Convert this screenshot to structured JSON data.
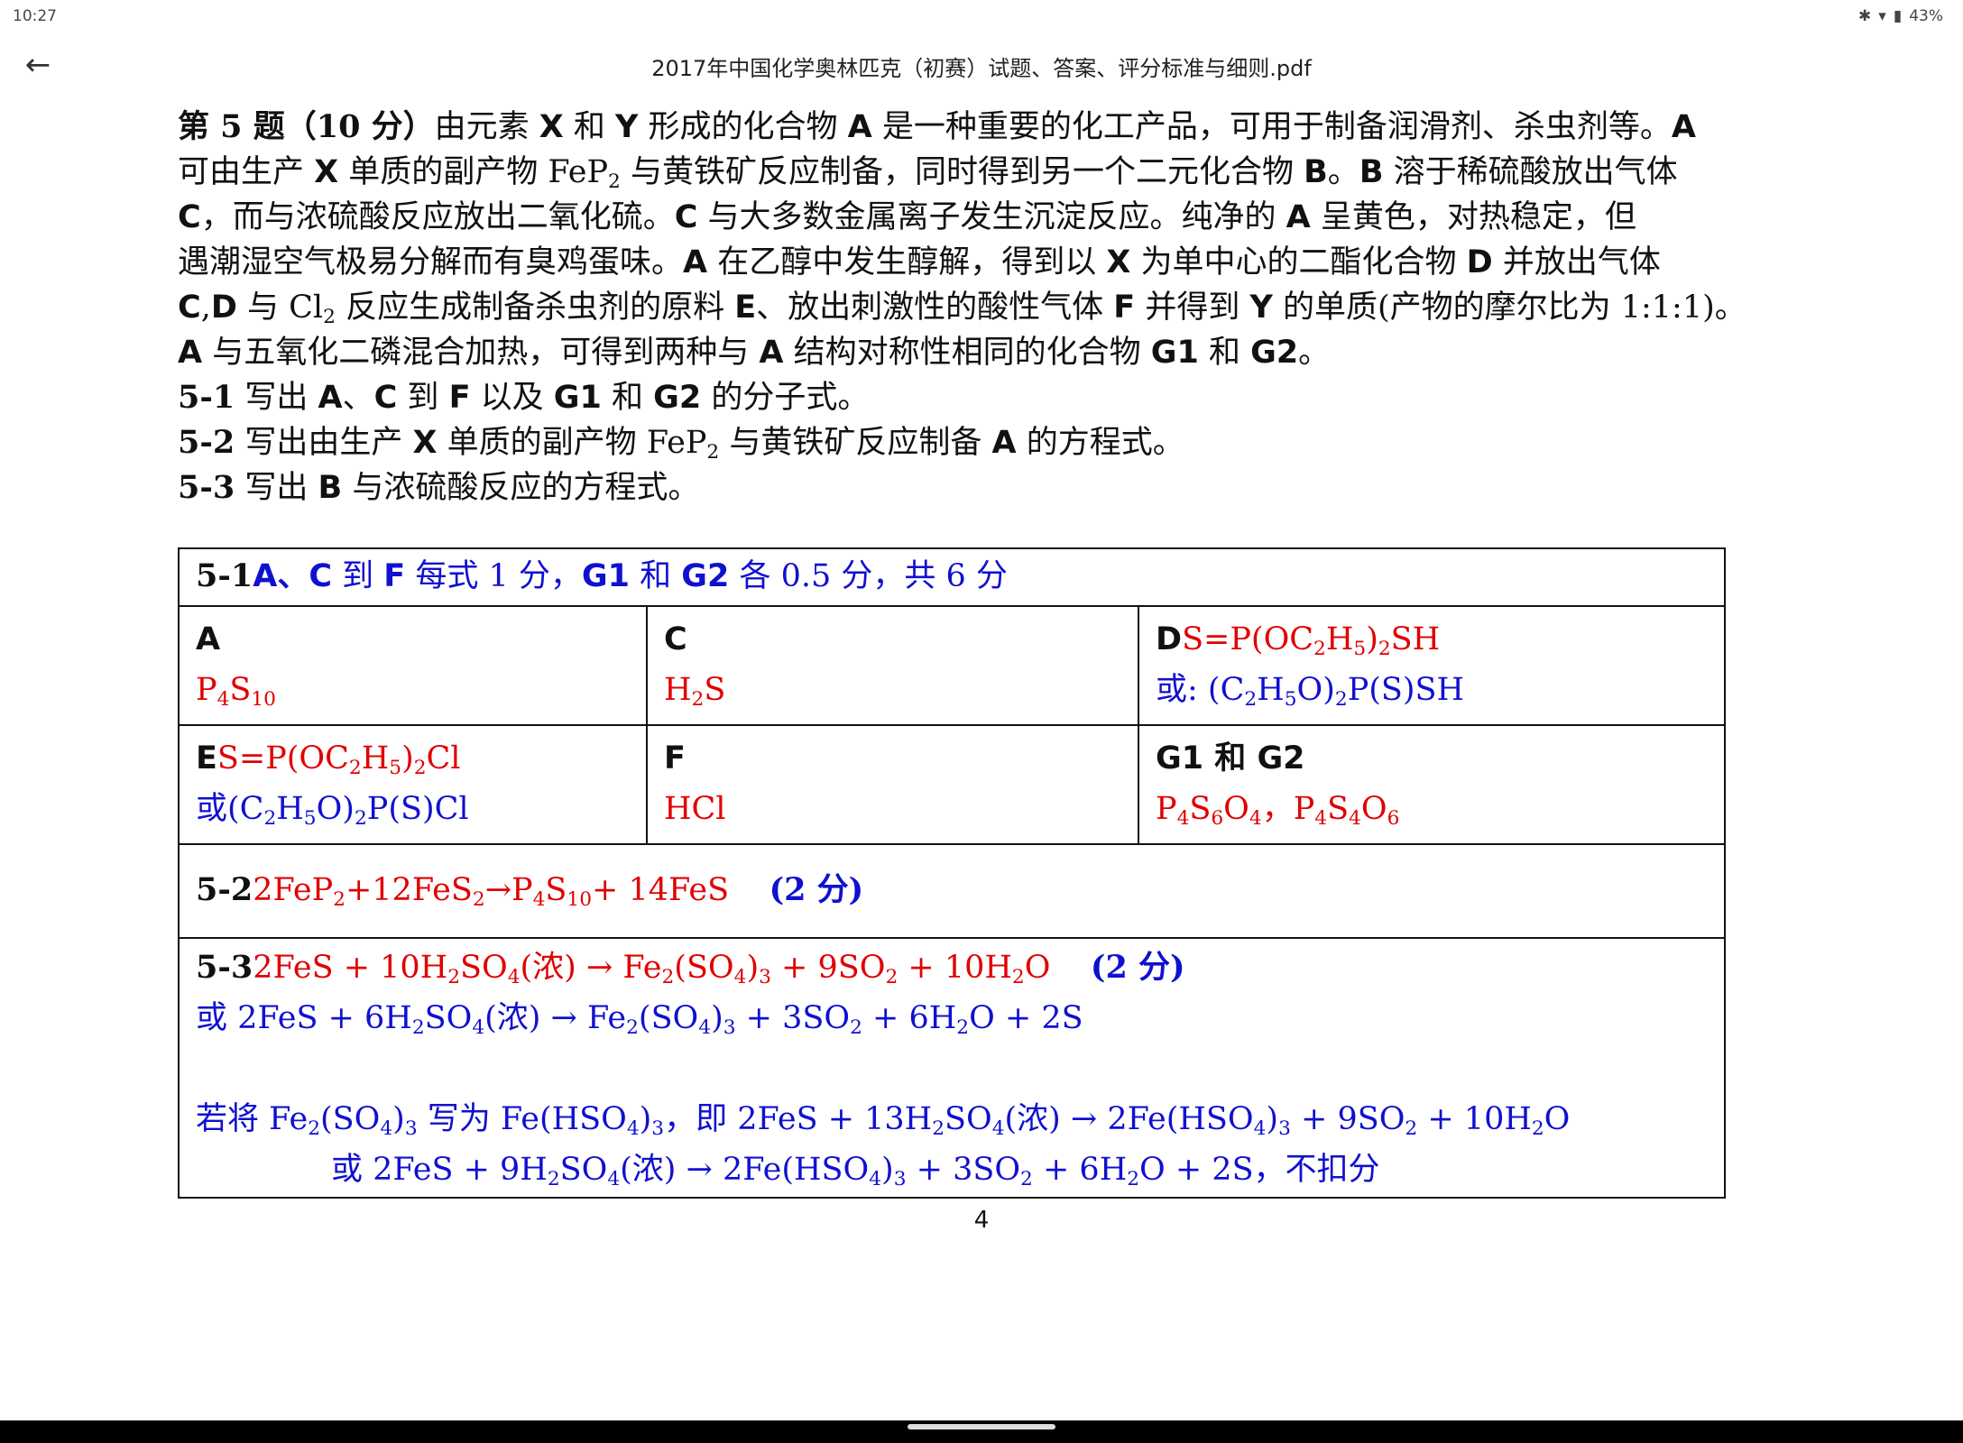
{
  "status": {
    "time": "10:27",
    "battery": "43%"
  },
  "header": {
    "title": "2017年中国化学奥林匹克（初赛）试题、答案、评分标准与细则.pdf"
  },
  "problem": {
    "l1a": "第 5 题（10 分）",
    "l1b": "由元素 ",
    "l1c": "X",
    "l1d": " 和 ",
    "l1e": "Y",
    "l1f": " 形成的化合物 ",
    "l1g": "A",
    "l1h": " 是一种重要的化工产品，可用于制备润滑剂、杀虫剂等。",
    "l1i": "A",
    "l2a": "可由生产 ",
    "l2b": "X",
    "l2c": " 单质的副产物 FeP",
    "l2d": "2",
    "l2e": " 与黄铁矿反应制备，同时得到另一个二元化合物 ",
    "l2f": "B",
    "l2g": "。",
    "l2h": "B",
    "l2i": " 溶于稀硫酸放出气体",
    "l3a": "C",
    "l3b": "，而与浓硫酸反应放出二氧化硫。",
    "l3c": "C",
    "l3d": " 与大多数金属离子发生沉淀反应。纯净的 ",
    "l3e": "A",
    "l3f": " 呈黄色，对热稳定，但",
    "l4a": "遇潮湿空气极易分解而有臭鸡蛋味。",
    "l4b": "A",
    "l4c": " 在乙醇中发生醇解，得到以 ",
    "l4d": "X",
    "l4e": " 为单中心的二酯化合物 ",
    "l4f": "D",
    "l4g": " 并放出气体",
    "l5a": "C",
    "l5b": ",",
    "l5c": "D",
    "l5d": " 与 Cl",
    "l5e": "2",
    "l5f": " 反应生成制备杀虫剂的原料 ",
    "l5g": "E",
    "l5h": "、放出刺激性的酸性气体 ",
    "l5i": "F",
    "l5j": " 并得到 ",
    "l5k": "Y",
    "l5l": " 的单质(产物的摩尔比为 1:1:1)。",
    "l6a": "A",
    "l6b": " 与五氧化二磷混合加热，可得到两种与 ",
    "l6c": "A",
    "l6d": " 结构对称性相同的化合物 ",
    "l6e": "G1",
    "l6f": " 和 ",
    "l6g": "G2",
    "l6h": "。",
    "q1a": "5-1",
    "q1b": " 写出 ",
    "q1c": "A",
    "q1d": "、",
    "q1e": "C",
    "q1f": " 到 ",
    "q1g": "F",
    "q1h": " 以及 ",
    "q1i": "G1",
    "q1j": " 和 ",
    "q1k": "G2",
    "q1l": " 的分子式。",
    "q2a": "5-2",
    "q2b": " 写出由生产 ",
    "q2c": "X",
    "q2d": " 单质的副产物 FeP",
    "q2e": "2",
    "q2f": " 与黄铁矿反应制备 ",
    "q2g": "A",
    "q2h": " 的方程式。",
    "q3a": "5-3",
    "q3b": " 写出 ",
    "q3c": "B",
    "q3d": " 与浓硫酸反应的方程式。"
  },
  "answer": {
    "h1a": "5-1",
    "h1b": "A、C",
    "h1c": " 到 ",
    "h1d": "F",
    "h1e": " 每式 1 分，",
    "h1f": "G1",
    "h1g": " 和 ",
    "h1h": "G2",
    "h1i": " 各 0.5 分，共 6 分",
    "A_label": "A",
    "A_val_a": "P",
    "A_val_b": "4",
    "A_val_c": "S",
    "A_val_d": "10",
    "C_label": "C",
    "C_val_a": "H",
    "C_val_b": "2",
    "C_val_c": "S",
    "D_label": "D",
    "D_a": "S=P(OC",
    "D_b": "2",
    "D_c": "H",
    "D_d": "5",
    "D_e": ")",
    "D_f": "2",
    "D_g": "SH",
    "D_alt_a": "或: (C",
    "D_alt_b": "2",
    "D_alt_c": "H",
    "D_alt_d": "5",
    "D_alt_e": "O)",
    "D_alt_f": "2",
    "D_alt_g": "P(S)SH",
    "E_label": "E",
    "E_a": "S=P(OC",
    "E_b": "2",
    "E_c": "H",
    "E_d": "5",
    "E_e": ")",
    "E_f": "2",
    "E_g": "Cl",
    "E_alt_a": "或(C",
    "E_alt_b": "2",
    "E_alt_c": "H",
    "E_alt_d": "5",
    "E_alt_e": "O)",
    "E_alt_f": "2",
    "E_alt_g": "P(S)Cl",
    "F_label": "F",
    "F_val": "HCl",
    "G_label": "G1 和 G2",
    "G_a": "P",
    "G_b": "4",
    "G_c": "S",
    "G_d": "6",
    "G_e": "O",
    "G_f": "4",
    "G_g": "，P",
    "G_h": "4",
    "G_i": "S",
    "G_j": "4",
    "G_k": "O",
    "G_l": "6",
    "q52_label": "5-2",
    "q52_a": "2FeP",
    "q52_b": "2",
    "q52_c": "+12FeS",
    "q52_d": "2",
    "q52_e": "→P",
    "q52_f": "4",
    "q52_g": "S",
    "q52_h": "10",
    "q52_i": "+ 14FeS",
    "q52_score": "(2 分)",
    "q53_label": "5-3",
    "e1_a": "2FeS + 10H",
    "e1_b": "2",
    "e1_c": "SO",
    "e1_d": "4",
    "e1_e": "(浓) → Fe",
    "e1_f": "2",
    "e1_g": "(SO",
    "e1_h": "4",
    "e1_i": ")",
    "e1_j": "3",
    "e1_k": " + 9SO",
    "e1_l": "2",
    "e1_m": " + 10H",
    "e1_n": "2",
    "e1_o": "O",
    "e1_score": "(2 分)",
    "e2_a": "或 2FeS + 6H",
    "e2_b": "2",
    "e2_c": "SO",
    "e2_d": "4",
    "e2_e": "(浓) → Fe",
    "e2_f": "2",
    "e2_g": "(SO",
    "e2_h": "4",
    "e2_i": ")",
    "e2_j": "3",
    "e2_k": " + 3SO",
    "e2_l": "2",
    "e2_m": " + 6H",
    "e2_n": "2",
    "e2_o": "O + 2S",
    "e3_a": "若将 Fe",
    "e3_b": "2",
    "e3_c": "(SO",
    "e3_d": "4",
    "e3_e": ")",
    "e3_f": "3",
    "e3_g": " 写为 Fe(HSO",
    "e3_h": "4",
    "e3_i": ")",
    "e3_j": "3",
    "e3_k": "，即 2FeS + 13H",
    "e3_l": "2",
    "e3_m": "SO",
    "e3_n": "4",
    "e3_o": "(浓) → 2Fe(HSO",
    "e3_p": "4",
    "e3_q": ")",
    "e3_r": "3",
    "e3_s": " + 9SO",
    "e3_t": "2",
    "e3_u": " + 10H",
    "e3_v": "2",
    "e3_w": "O",
    "e4_a": "或 2FeS + 9H",
    "e4_b": "2",
    "e4_c": "SO",
    "e4_d": "4",
    "e4_e": "(浓) → 2Fe(HSO",
    "e4_f": "4",
    "e4_g": ")",
    "e4_h": "3",
    "e4_i": " + 3SO",
    "e4_j": "2",
    "e4_k": " + 6H",
    "e4_l": "2",
    "e4_m": "O + 2S，不扣分"
  },
  "page_number": "4",
  "colors": {
    "red": "#e00000",
    "blue": "#1010d0"
  }
}
